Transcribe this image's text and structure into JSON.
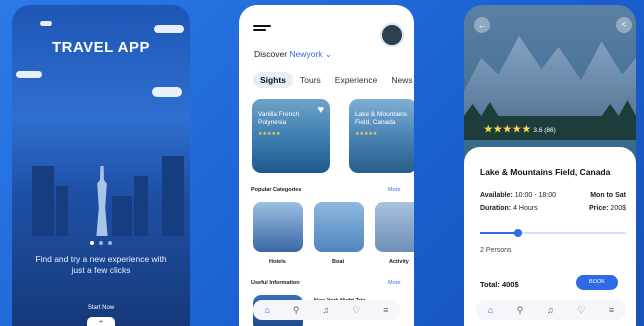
{
  "screen1": {
    "title": "TRAVEL APP",
    "tagline": "Find and try a new experience with just a few clicks",
    "start": "Start Now",
    "up_icon": "chevron-up-icon"
  },
  "screen2": {
    "discover": "Discover",
    "location": "Newyork",
    "tabs": [
      {
        "label": "Sights",
        "active": true
      },
      {
        "label": "Tours",
        "active": false
      },
      {
        "label": "Experience",
        "active": false
      },
      {
        "label": "News",
        "active": false
      }
    ],
    "cards": [
      {
        "name": "Vanilla French Polynesia",
        "stars": "★★★★★"
      },
      {
        "name": "Lake & Mountains Field, Canada",
        "stars": "★★★★★"
      }
    ],
    "popular": "Popular Categories",
    "more1": "More",
    "categories": [
      "Hotels",
      "Boat",
      "Activity"
    ],
    "useful": "Useful Information",
    "more2": "More",
    "info_item": "New York Night Trip",
    "nav": [
      "home-icon",
      "search-icon",
      "bell-icon",
      "heart-icon",
      "menu-icon"
    ]
  },
  "screen3": {
    "rating_stars": "★★★★★",
    "rating": "3.6 (86)",
    "place": "Lake & Mountains Field, Canada",
    "available_label": "Available:",
    "available": "10:00 - 18:00",
    "days": "Mon to Sat",
    "duration_label": "Duration:",
    "duration": "4 Hours",
    "price_label": "Price:",
    "price": "200$",
    "persons": "2 Persons",
    "persons_level": 0.26,
    "total": "Total: 400$",
    "book": "BOOK"
  },
  "colors": {
    "accent": "#2e6ae6",
    "background": "#1f6bd8",
    "star": "#ffd84a"
  }
}
